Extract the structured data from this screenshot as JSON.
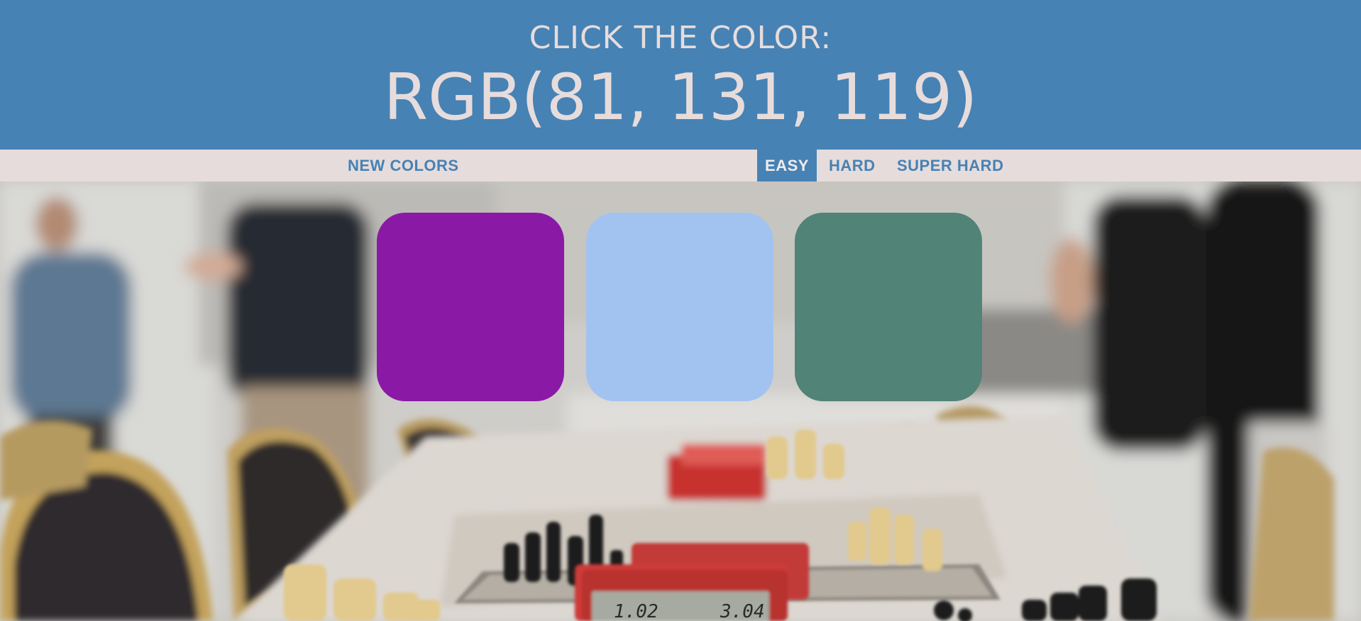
{
  "header": {
    "prompt": "CLICK THE COLOR:",
    "target": "RGB(81, 131, 119)",
    "background_color": "#4682b4",
    "text_color": "#e7dcdc"
  },
  "toolbar": {
    "new_colors_label": "NEW COLORS",
    "modes": [
      {
        "label": "EASY",
        "selected": true
      },
      {
        "label": "HARD",
        "selected": false
      },
      {
        "label": "SUPER HARD",
        "selected": false
      }
    ],
    "background_color": "#e6dcdc",
    "accent_color": "#4682b4"
  },
  "swatches": [
    {
      "color": "#8a1aa6"
    },
    {
      "color": "#a2c3f0"
    },
    {
      "color": "#518377"
    }
  ],
  "background": {
    "description_icon": "chess-tournament-photo",
    "clock_left": "1.02",
    "clock_right": "3.04"
  }
}
